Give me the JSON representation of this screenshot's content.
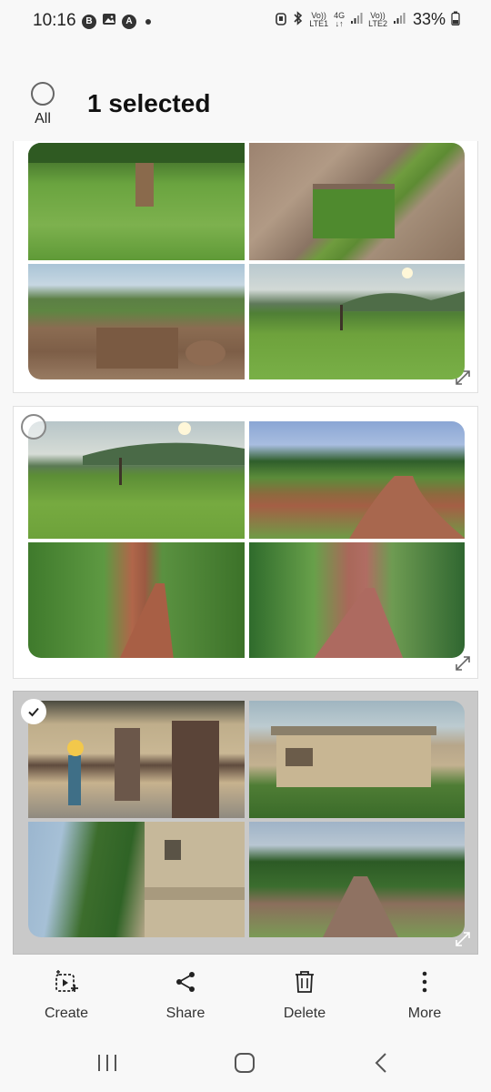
{
  "status_bar": {
    "time": "10:16",
    "left_icons": [
      "b-icon",
      "gallery-icon",
      "a-icon",
      "dot-icon"
    ],
    "sim1": {
      "top": "Vo))",
      "bottom": "LTE1"
    },
    "net_type": "4G",
    "sim2": {
      "top": "Vo))",
      "bottom": "LTE2"
    },
    "battery": "33%"
  },
  "header": {
    "select_all_label": "All",
    "title": "1 selected"
  },
  "groups": [
    {
      "selected": false,
      "photos": [
        "field",
        "stones",
        "ruins",
        "hills"
      ]
    },
    {
      "selected": false,
      "photos": [
        "hills",
        "path",
        "path",
        "path"
      ]
    },
    {
      "selected": true,
      "photos": [
        "building",
        "building",
        "building",
        "path"
      ]
    }
  ],
  "actions": [
    {
      "label": "Create",
      "icon": "create-icon"
    },
    {
      "label": "Share",
      "icon": "share-icon"
    },
    {
      "label": "Delete",
      "icon": "trash-icon"
    },
    {
      "label": "More",
      "icon": "more-icon"
    }
  ],
  "nav": [
    "recents-icon",
    "home-icon",
    "back-icon"
  ],
  "colors": {
    "selected_bg": "#c9c9c9",
    "card_bg": "#ffffff",
    "page_bg": "#f8f8f8"
  }
}
